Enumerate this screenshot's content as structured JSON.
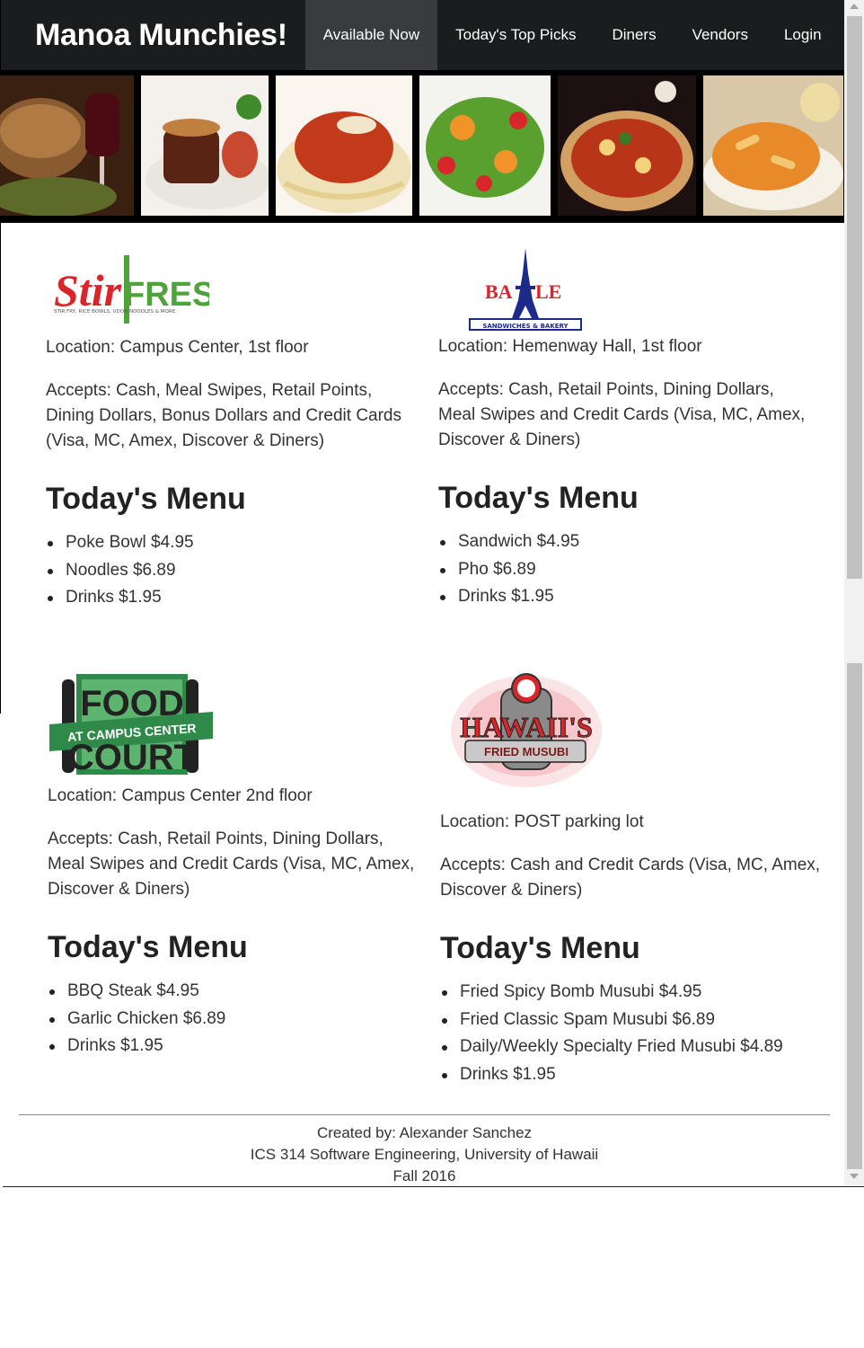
{
  "navbar": {
    "brand": "Manoa Munchies!",
    "items": [
      {
        "label": "Available Now",
        "active": true
      },
      {
        "label": "Today's Top Picks",
        "active": false
      },
      {
        "label": "Diners",
        "active": false
      },
      {
        "label": "Vendors",
        "active": false
      },
      {
        "label": "Login",
        "active": false
      }
    ]
  },
  "banner": {
    "tiles": [
      "bread-and-wine-photo",
      "steak-photo",
      "spaghetti-photo",
      "salad-photo",
      "pizza-photo",
      "penne-pasta-photo"
    ]
  },
  "vendors": [
    {
      "logo": {
        "name": "stir-fresh-logo",
        "text": "StirFresh",
        "tagline": "STIR FRY, RICE BOWLS, UDON NOODLES & MORE"
      },
      "location": "Location: Campus Center, 1st floor",
      "accepts": "Accepts: Cash, Meal Swipes, Retail Points, Dining Dollars, Bonus Dollars and Credit Cards (Visa, MC, Amex, Discover & Diners)",
      "menu_title": "Today's Menu",
      "menu": [
        "Poke Bowl $4.95",
        "Noodles $6.89",
        "Drinks $1.95"
      ]
    },
    {
      "logo": {
        "name": "ba-le-logo",
        "text": "BA LE",
        "tagline": "SANDWICHES & BAKERY"
      },
      "location": "Location: Hemenway Hall, 1st floor",
      "accepts": "Accepts: Cash, Retail Points, Dining Dollars, Meal Swipes and Credit Cards (Visa, MC, Amex, Discover & Diners)",
      "menu_title": "Today's Menu",
      "menu": [
        "Sandwich $4.95",
        "Pho $6.89",
        "Drinks $1.95"
      ]
    },
    {
      "logo": {
        "name": "food-court-logo",
        "text_top": "FOOD",
        "text_mid": "AT CAMPUS CENTER",
        "text_bottom": "COURT"
      },
      "location": "Location: Campus Center 2nd floor",
      "accepts": "Accepts: Cash, Retail Points, Dining Dollars, Meal Swipes and Credit Cards (Visa, MC, Amex, Discover & Diners)",
      "menu_title": "Today's Menu",
      "menu": [
        "BBQ Steak $4.95",
        "Garlic Chicken $6.89",
        "Drinks $1.95"
      ]
    },
    {
      "logo": {
        "name": "hawaiis-fried-musubi-logo",
        "text": "HAWAII'S",
        "tagline": "FRIED MUSUBI"
      },
      "location": "Location: POST parking lot",
      "accepts": "Accepts: Cash and Credit Cards (Visa, MC, Amex, Discover & Diners)",
      "menu_title": "Today's Menu",
      "menu": [
        "Fried Spicy Bomb Musubi $4.95",
        "Fried Classic Spam Musubi $6.89",
        "Daily/Weekly Specialty Fried Musubi $4.89",
        "Drinks $1.95"
      ]
    }
  ],
  "footer": {
    "line1": "Created by: Alexander Sanchez",
    "line2": "ICS 314 Software Engineering, University of Hawaii",
    "line3": "Fall 2016"
  }
}
